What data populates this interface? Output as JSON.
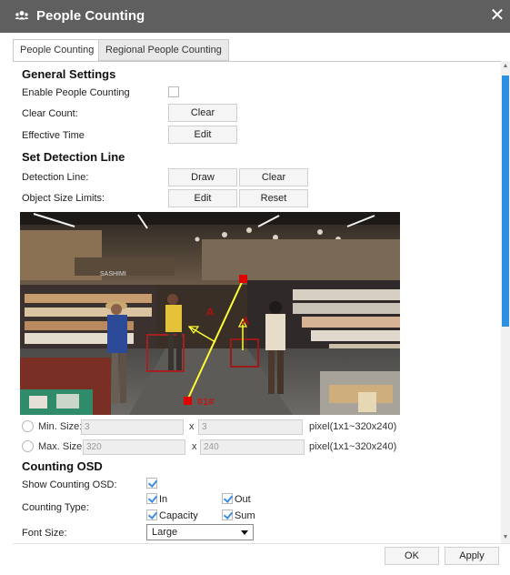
{
  "window": {
    "title": "People Counting",
    "icon": "people-group-icon",
    "close_icon": "close-icon"
  },
  "tabs": [
    {
      "label": "People Counting",
      "active": true
    },
    {
      "label": "Regional People Counting",
      "active": false
    }
  ],
  "general": {
    "heading": "General Settings",
    "enable_label": "Enable People Counting",
    "enable_checked": false,
    "clear_count_label": "Clear Count:",
    "clear_button": "Clear",
    "effective_time_label": "Effective Time",
    "edit_button": "Edit"
  },
  "detection": {
    "heading": "Set Detection Line",
    "line_label": "Detection Line:",
    "draw_button": "Draw",
    "clear_button": "Clear",
    "object_size_label": "Object Size Limits:",
    "edit_button": "Edit",
    "reset_button": "Reset"
  },
  "video": {
    "line_label": "#1#",
    "direction_label_a1": "A",
    "direction_label_a2": "A",
    "sign_text": "SASHIMI",
    "accent_color": "#ffff33",
    "marker_color": "#e00000"
  },
  "size_limits": {
    "min": {
      "label": "Min. Size:",
      "width": "3",
      "height": "3",
      "range": "pixel(1x1~320x240)"
    },
    "max": {
      "label": "Max. Size:",
      "width": "320",
      "height": "240",
      "range": "pixel(1x1~320x240)"
    },
    "x_sign": "x"
  },
  "osd": {
    "heading": "Counting OSD",
    "show_label": "Show Counting OSD:",
    "show_checked": true,
    "type_label": "Counting Type:",
    "types": [
      {
        "label": "In",
        "checked": true
      },
      {
        "label": "Out",
        "checked": true
      },
      {
        "label": "Capacity",
        "checked": true
      },
      {
        "label": "Sum",
        "checked": true
      }
    ],
    "font_size_label": "Font Size:",
    "font_size_value": "Large"
  },
  "footer": {
    "ok": "OK",
    "apply": "Apply"
  },
  "colors": {
    "titlebar": "#5f5f5f",
    "accent": "#2d8fe0"
  }
}
